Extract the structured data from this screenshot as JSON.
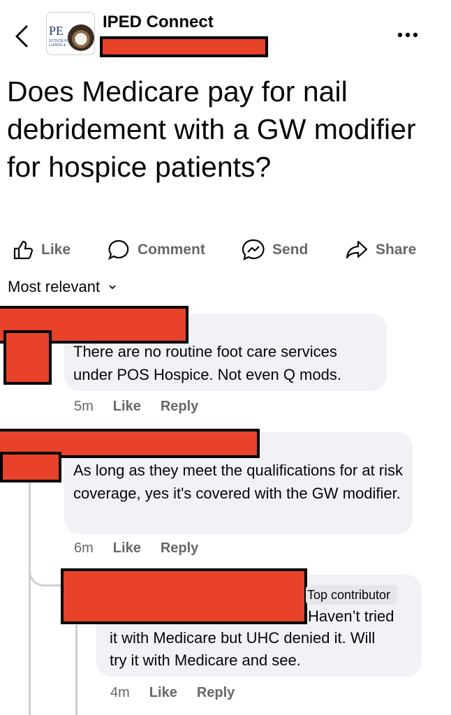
{
  "header": {
    "group_name": "IPED Connect",
    "logo_text": "PE",
    "logo_subtext": "STITUTE FO LLENCE &"
  },
  "post": {
    "title": "Does Medicare pay for nail debridement with a GW modifier for hospice patients?"
  },
  "actions": {
    "like": "Like",
    "comment": "Comment",
    "send": "Send",
    "share": "Share"
  },
  "sort_label": "Most relevant",
  "comments": [
    {
      "text": "There are no routine foot care services under POS Hospice. Not even Q mods.",
      "time": "5m",
      "like": "Like",
      "reply": "Reply"
    },
    {
      "text": "As long as they meet the qualifications for at risk coverage, yes it's covered with the GW modifier.",
      "time": "6m",
      "like": "Like",
      "reply": "Reply"
    }
  ],
  "reply": {
    "badge": "Top contributor",
    "text_line1": "Haven’t tried",
    "text_rest": "it with Medicare but UHC denied it. Will try it with Medicare and see.",
    "time": "4m",
    "like": "Like",
    "reply": "Reply"
  },
  "colors": {
    "redaction": "#e8432a",
    "bubble": "#f0f2f5",
    "meta": "#65676b"
  }
}
